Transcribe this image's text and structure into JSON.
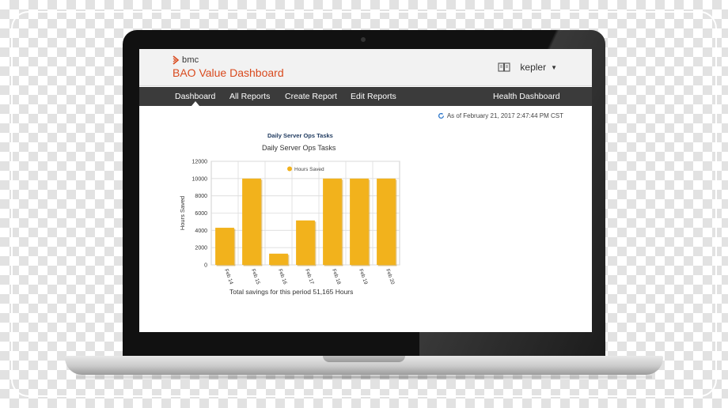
{
  "brand": {
    "logo_text": "bmc",
    "app_title": "BAO Value Dashboard",
    "accent_color": "#d94a1e"
  },
  "user": {
    "name": "kepler",
    "library_icon": "book-icon",
    "menu_icon": "caret-down-icon"
  },
  "nav": {
    "items": [
      {
        "label": "Dashboard",
        "active": true
      },
      {
        "label": "All Reports"
      },
      {
        "label": "Create Report"
      },
      {
        "label": "Edit Reports"
      },
      {
        "label": "Health Dashboard"
      }
    ]
  },
  "status": {
    "timestamp": "As of February 21, 2017 2:47:44 PM CST",
    "icon": "refresh-icon"
  },
  "report": {
    "heading": "Daily Server Ops Tasks",
    "summary": "Total savings for this period 51,165 Hours"
  },
  "chart_data": {
    "type": "bar",
    "title": "Daily Server Ops Tasks",
    "xlabel": "",
    "ylabel": "Hours Saved",
    "categories": [
      "Feb 14",
      "Feb 15",
      "Feb 16",
      "Feb 17",
      "Feb 18",
      "Feb 19",
      "Feb 20"
    ],
    "series": [
      {
        "name": "Hours Saved",
        "color": "#f2b21c",
        "values": [
          4300,
          10000,
          1300,
          5150,
          10000,
          10000,
          10000
        ]
      }
    ],
    "ylim": [
      0,
      12000
    ],
    "yticks": [
      "0",
      "2000",
      "4000",
      "6000",
      "8000",
      "10000",
      "12000"
    ],
    "grid": true,
    "legend": "top-center"
  }
}
